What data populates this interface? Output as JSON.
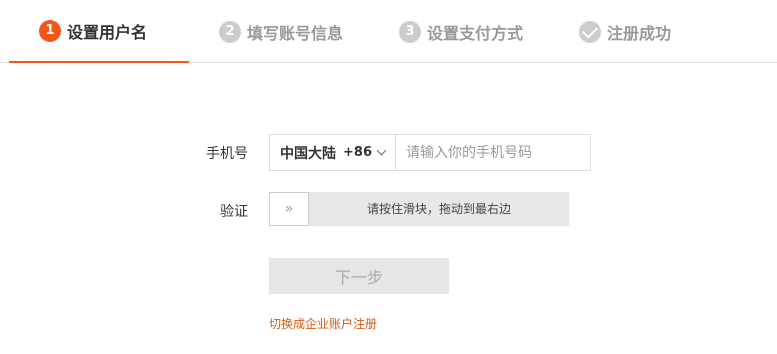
{
  "colors": {
    "accent": "#f25618",
    "inactive": "#cccccc",
    "link": "#d55b16"
  },
  "steps": [
    {
      "number": "1",
      "label": "设置用户名",
      "state": "active"
    },
    {
      "number": "2",
      "label": "填写账号信息",
      "state": "inactive"
    },
    {
      "number": "3",
      "label": "设置支付方式",
      "state": "inactive"
    },
    {
      "icon": "checkmark-icon",
      "label": "注册成功",
      "state": "inactive"
    }
  ],
  "form": {
    "phone_label": "手机号",
    "region_name": "中国大陆",
    "region_code": "+86",
    "phone_placeholder": "请输入你的手机号码",
    "phone_value": "",
    "verify_label": "验证",
    "slider_handle": "»",
    "slider_text": "请按住滑块，拖动到最右边",
    "next_button": "下一步",
    "switch_link": "切换成企业账户注册"
  }
}
